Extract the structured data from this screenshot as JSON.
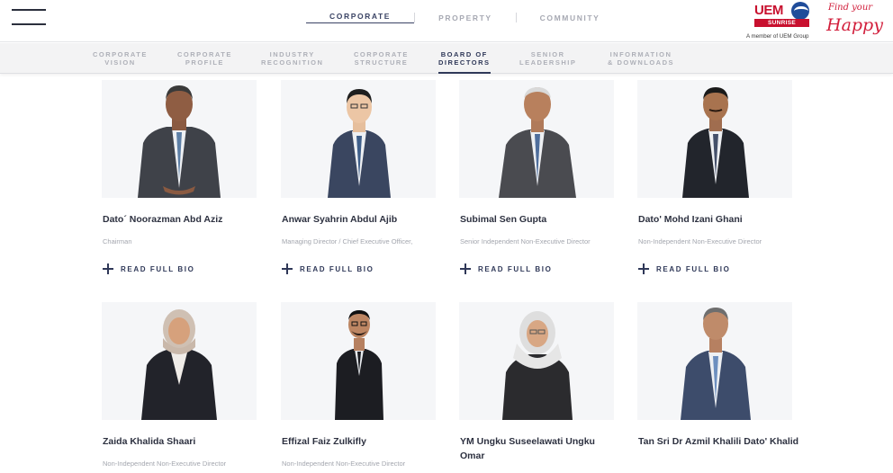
{
  "header": {
    "menu_icon": "hamburger-icon",
    "nav": [
      "CORPORATE",
      "PROPERTY",
      "COMMUNITY"
    ],
    "active_nav": "CORPORATE",
    "logo": {
      "brand": "UEM",
      "sub": "SUNRISE",
      "member": "A member of UEM Group"
    },
    "tagline": {
      "line1": "Find your",
      "line2": "Happy"
    }
  },
  "subnav": [
    {
      "line1": "CORPORATE",
      "line2": "VISION"
    },
    {
      "line1": "CORPORATE",
      "line2": "PROFILE"
    },
    {
      "line1": "INDUSTRY",
      "line2": "RECOGNITION"
    },
    {
      "line1": "CORPORATE",
      "line2": "STRUCTURE"
    },
    {
      "line1": "BOARD OF",
      "line2": "DIRECTORS"
    },
    {
      "line1": "SENIOR",
      "line2": "LEADERSHIP"
    },
    {
      "line1": "INFORMATION",
      "line2": "& DOWNLOADS"
    }
  ],
  "read_more_label": "READ FULL BIO",
  "directors": [
    {
      "name": "Dato´ Noorazman Abd Aziz",
      "role": "Chairman"
    },
    {
      "name": "Anwar Syahrin Abdul Ajib",
      "role": "Managing Director / Chief Executive Officer,"
    },
    {
      "name": "Subimal Sen Gupta",
      "role": "Senior Independent Non-Executive Director"
    },
    {
      "name": "Dato' Mohd Izani Ghani",
      "role": "Non-Independent Non-Executive Director"
    },
    {
      "name": "Zaida Khalida Shaari",
      "role": "Non-Independent Non-Executive Director"
    },
    {
      "name": "Effizal Faiz Zulkifly",
      "role": "Non-Independent Non-Executive Director"
    },
    {
      "name": "YM Ungku Suseelawati Ungku Omar",
      "role": ""
    },
    {
      "name": "Tan Sri Dr Azmil Khalili Dato' Khalid",
      "role": ""
    }
  ],
  "colors": {
    "accent": "#2f3858",
    "brand_red": "#c8102e",
    "muted": "#a3a6ae"
  }
}
